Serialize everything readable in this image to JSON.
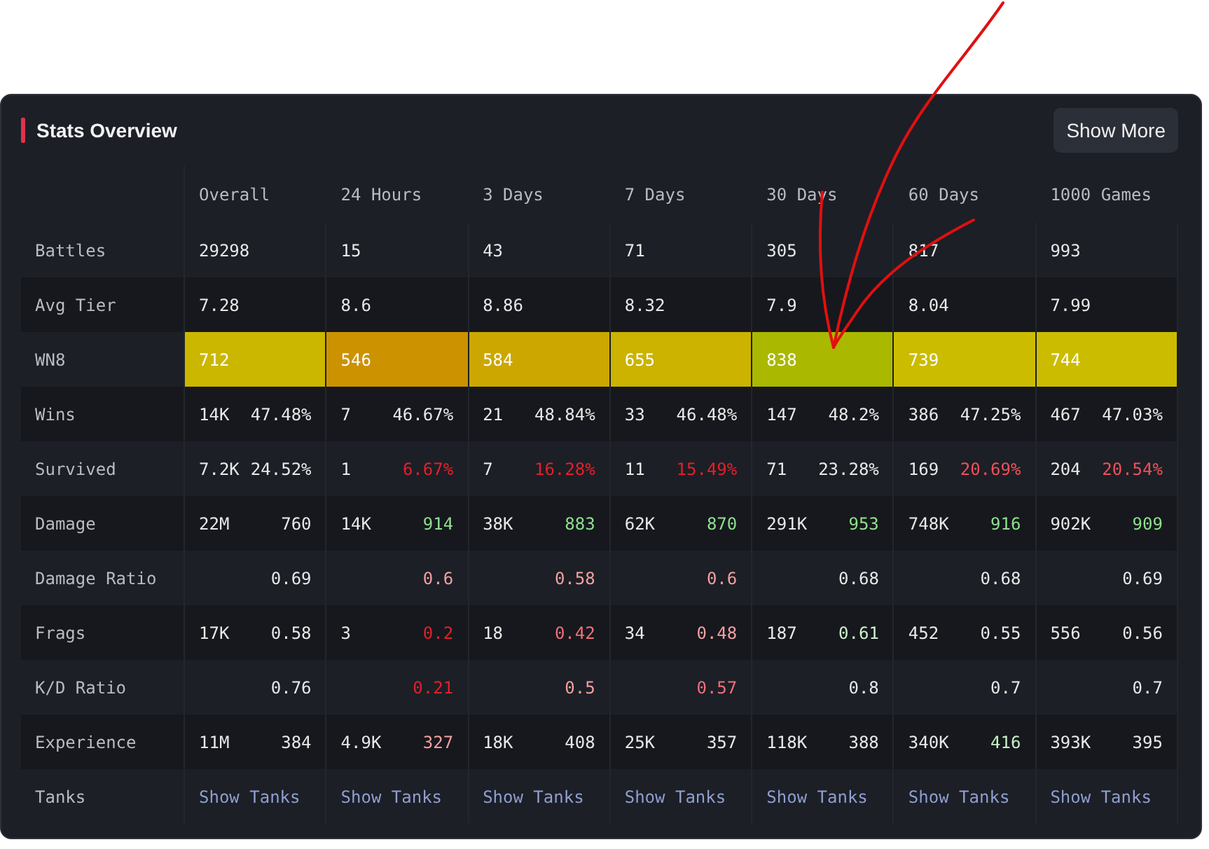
{
  "panel": {
    "title": "Stats Overview",
    "button": "Show More"
  },
  "columns": [
    "Overall",
    "24 Hours",
    "3 Days",
    "7 Days",
    "30 Days",
    "60 Days",
    "1000 Games"
  ],
  "rows": [
    {
      "label": "Battles",
      "kind": "stat",
      "cells": [
        {
          "value": "29298"
        },
        {
          "value": "15"
        },
        {
          "value": "43"
        },
        {
          "value": "71"
        },
        {
          "value": "305"
        },
        {
          "value": "817"
        },
        {
          "value": "993"
        }
      ]
    },
    {
      "label": "Avg Tier",
      "kind": "stat",
      "cells": [
        {
          "value": "7.28"
        },
        {
          "value": "8.6"
        },
        {
          "value": "8.86"
        },
        {
          "value": "8.32"
        },
        {
          "value": "7.9"
        },
        {
          "value": "8.04"
        },
        {
          "value": "7.99"
        }
      ]
    },
    {
      "label": "WN8",
      "kind": "rating",
      "cells": [
        {
          "value": "712",
          "color": "#cbb700"
        },
        {
          "value": "546",
          "color": "#cc9200"
        },
        {
          "value": "584",
          "color": "#cca700"
        },
        {
          "value": "655",
          "color": "#cbb300"
        },
        {
          "value": "838",
          "color": "#aab800"
        },
        {
          "value": "739",
          "color": "#cbbc00"
        },
        {
          "value": "744",
          "color": "#cbbc00"
        }
      ]
    },
    {
      "label": "Wins",
      "kind": "pair",
      "cells": [
        {
          "count": "14K",
          "value": "47.48%",
          "color": "#e8e8e8"
        },
        {
          "count": "7",
          "value": "46.67%",
          "color": "#e8e8e8"
        },
        {
          "count": "21",
          "value": "48.84%",
          "color": "#e8e8e8"
        },
        {
          "count": "33",
          "value": "46.48%",
          "color": "#e8e8e8"
        },
        {
          "count": "147",
          "value": "48.2%",
          "color": "#e8e8e8"
        },
        {
          "count": "386",
          "value": "47.25%",
          "color": "#e8e8e8"
        },
        {
          "count": "467",
          "value": "47.03%",
          "color": "#e8e8e8"
        }
      ]
    },
    {
      "label": "Survived",
      "kind": "pair",
      "cells": [
        {
          "count": "7.2K",
          "value": "24.52%",
          "color": "#e8e8e8"
        },
        {
          "count": "1",
          "value": "6.67%",
          "color": "#e3202a"
        },
        {
          "count": "7",
          "value": "16.28%",
          "color": "#e3202a"
        },
        {
          "count": "11",
          "value": "15.49%",
          "color": "#e3202a"
        },
        {
          "count": "71",
          "value": "23.28%",
          "color": "#e8e8e8"
        },
        {
          "count": "169",
          "value": "20.69%",
          "color": "#f0505a"
        },
        {
          "count": "204",
          "value": "20.54%",
          "color": "#f0505a"
        }
      ]
    },
    {
      "label": "Damage",
      "kind": "pair",
      "cells": [
        {
          "count": "22M",
          "value": "760",
          "color": "#e8e8e8"
        },
        {
          "count": "14K",
          "value": "914",
          "color": "#8ee08e"
        },
        {
          "count": "38K",
          "value": "883",
          "color": "#8ee08e"
        },
        {
          "count": "62K",
          "value": "870",
          "color": "#8ee08e"
        },
        {
          "count": "291K",
          "value": "953",
          "color": "#8ee08e"
        },
        {
          "count": "748K",
          "value": "916",
          "color": "#8ee08e"
        },
        {
          "count": "902K",
          "value": "909",
          "color": "#8ee08e"
        }
      ]
    },
    {
      "label": "Damage Ratio",
      "kind": "pair",
      "cells": [
        {
          "value": "0.69",
          "color": "#e8e8e8"
        },
        {
          "value": "0.6",
          "color": "#f3a0a0"
        },
        {
          "value": "0.58",
          "color": "#f3a0a0"
        },
        {
          "value": "0.6",
          "color": "#f3a0a0"
        },
        {
          "value": "0.68",
          "color": "#e8e8e8"
        },
        {
          "value": "0.68",
          "color": "#e8e8e8"
        },
        {
          "value": "0.69",
          "color": "#e8e8e8"
        }
      ]
    },
    {
      "label": "Frags",
      "kind": "pair",
      "cells": [
        {
          "count": "17K",
          "value": "0.58",
          "color": "#e8e8e8"
        },
        {
          "count": "3",
          "value": "0.2",
          "color": "#e3202a"
        },
        {
          "count": "18",
          "value": "0.42",
          "color": "#f07078"
        },
        {
          "count": "34",
          "value": "0.48",
          "color": "#f3a0a0"
        },
        {
          "count": "187",
          "value": "0.61",
          "color": "#d0f0d0"
        },
        {
          "count": "452",
          "value": "0.55",
          "color": "#e8e8e8"
        },
        {
          "count": "556",
          "value": "0.56",
          "color": "#e8e8e8"
        }
      ]
    },
    {
      "label": "K/D Ratio",
      "kind": "pair",
      "cells": [
        {
          "value": "0.76",
          "color": "#e8e8e8"
        },
        {
          "value": "0.21",
          "color": "#e3202a"
        },
        {
          "value": "0.5",
          "color": "#f3a0a0"
        },
        {
          "value": "0.57",
          "color": "#f07078"
        },
        {
          "value": "0.8",
          "color": "#e8e8e8"
        },
        {
          "value": "0.7",
          "color": "#e8e8e8"
        },
        {
          "value": "0.7",
          "color": "#e8e8e8"
        }
      ]
    },
    {
      "label": "Experience",
      "kind": "pair",
      "cells": [
        {
          "count": "11M",
          "value": "384",
          "color": "#e8e8e8"
        },
        {
          "count": "4.9K",
          "value": "327",
          "color": "#f3a0a0"
        },
        {
          "count": "18K",
          "value": "408",
          "color": "#e8e8e8"
        },
        {
          "count": "25K",
          "value": "357",
          "color": "#e8e8e8"
        },
        {
          "count": "118K",
          "value": "388",
          "color": "#e8e8e8"
        },
        {
          "count": "340K",
          "value": "416",
          "color": "#c8f0c8"
        },
        {
          "count": "393K",
          "value": "395",
          "color": "#e8e8e8"
        }
      ]
    },
    {
      "label": "Tanks",
      "kind": "link",
      "cells": [
        {
          "value": "Show Tanks"
        },
        {
          "value": "Show Tanks"
        },
        {
          "value": "Show Tanks"
        },
        {
          "value": "Show Tanks"
        },
        {
          "value": "Show Tanks"
        },
        {
          "value": "Show Tanks"
        },
        {
          "value": "Show Tanks"
        }
      ]
    }
  ]
}
